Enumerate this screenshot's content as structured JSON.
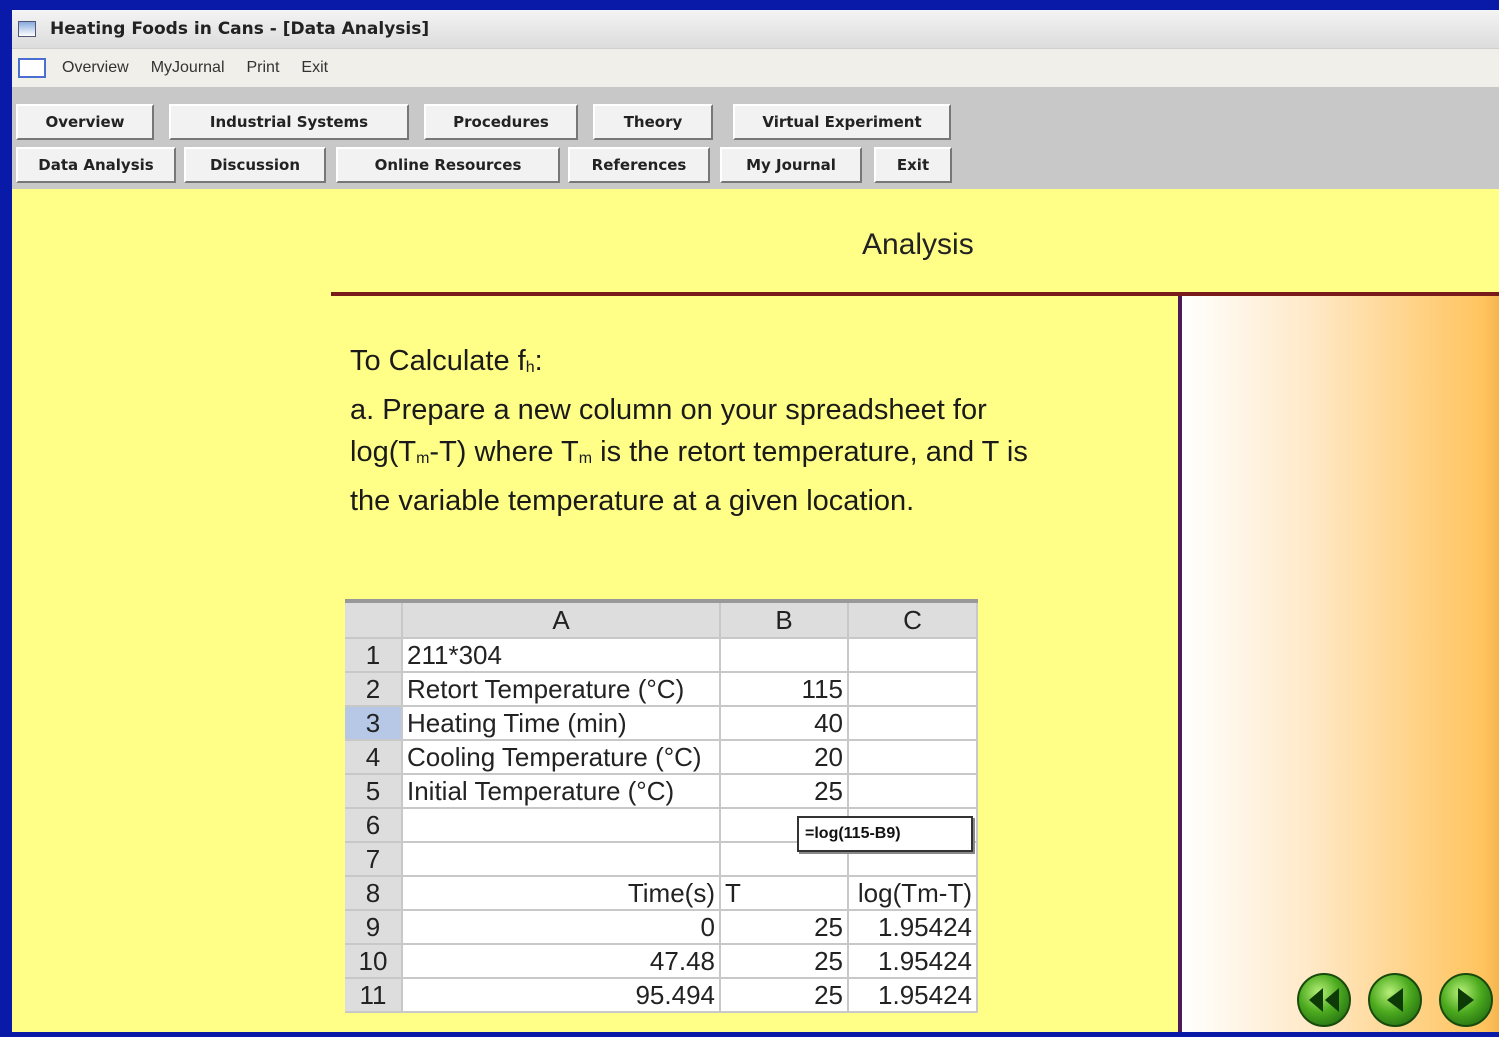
{
  "window": {
    "title": "Heating Foods in Cans - [Data Analysis]"
  },
  "menu": [
    "Overview",
    "MyJournal",
    "Print",
    "Exit"
  ],
  "nav": {
    "row1": [
      "Overview",
      "Industrial Systems",
      "Procedures",
      "Theory",
      "Virtual Experiment"
    ],
    "row2": [
      "Data Analysis",
      "Discussion",
      "Online Resources",
      "References",
      "My Journal",
      "Exit"
    ]
  },
  "page": {
    "heading": "Analysis",
    "intro_line1_prefix": "To Calculate f",
    "intro_line1_sub": "h",
    "intro_line1_suffix": ":",
    "step_a_1": "a. Prepare a new column on your spreadsheet for",
    "step_a_2_prefix": "log(T",
    "step_a_2_sub1": "m",
    "step_a_2_mid": "-T) where T",
    "step_a_2_sub2": "m",
    "step_a_2_suffix": " is the retort temperature, and T is",
    "step_a_3": "the variable temperature at a given location."
  },
  "spreadsheet": {
    "columns": [
      "A",
      "B",
      "C"
    ],
    "rows": [
      {
        "n": "1",
        "a": "211*304",
        "b": "",
        "c": ""
      },
      {
        "n": "2",
        "a": "Retort Temperature (°C)",
        "b": "115",
        "c": ""
      },
      {
        "n": "3",
        "a": "Heating Time (min)",
        "b": "40",
        "c": ""
      },
      {
        "n": "4",
        "a": "Cooling Temperature (°C)",
        "b": "20",
        "c": ""
      },
      {
        "n": "5",
        "a": "Initial Temperature (°C)",
        "b": "25",
        "c": ""
      },
      {
        "n": "6",
        "a": "",
        "b": "",
        "c": ""
      },
      {
        "n": "7",
        "a": "",
        "b": "",
        "c": ""
      },
      {
        "n": "8",
        "a": "Time(s)",
        "b": "T",
        "c": "log(Tm-T)"
      },
      {
        "n": "9",
        "a": "0",
        "b": "25",
        "c": "1.95424"
      },
      {
        "n": "10",
        "a": "47.48",
        "b": "25",
        "c": "1.95424"
      },
      {
        "n": "11",
        "a": "95.494",
        "b": "25",
        "c": "1.95424"
      }
    ],
    "formula_tooltip": "=log(115-B9)"
  },
  "nav_arrows": [
    "first-icon",
    "back-icon",
    "forward-icon"
  ]
}
